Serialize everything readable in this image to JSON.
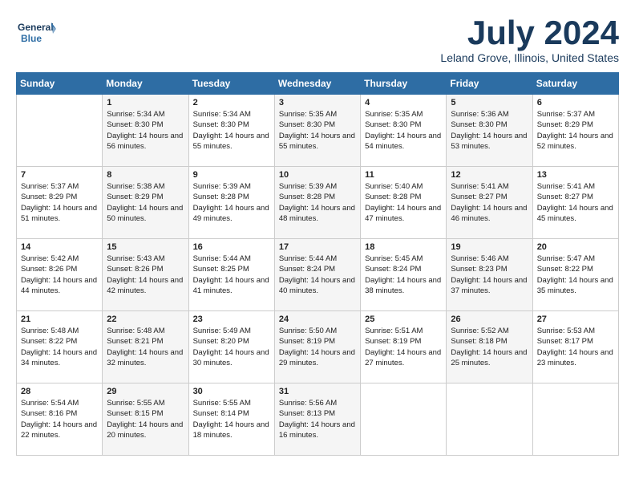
{
  "header": {
    "logo_line1": "General",
    "logo_line2": "Blue",
    "month": "July 2024",
    "location": "Leland Grove, Illinois, United States"
  },
  "days_of_week": [
    "Sunday",
    "Monday",
    "Tuesday",
    "Wednesday",
    "Thursday",
    "Friday",
    "Saturday"
  ],
  "weeks": [
    [
      {
        "num": "",
        "sunrise": "",
        "sunset": "",
        "daylight": ""
      },
      {
        "num": "1",
        "sunrise": "Sunrise: 5:34 AM",
        "sunset": "Sunset: 8:30 PM",
        "daylight": "Daylight: 14 hours and 56 minutes."
      },
      {
        "num": "2",
        "sunrise": "Sunrise: 5:34 AM",
        "sunset": "Sunset: 8:30 PM",
        "daylight": "Daylight: 14 hours and 55 minutes."
      },
      {
        "num": "3",
        "sunrise": "Sunrise: 5:35 AM",
        "sunset": "Sunset: 8:30 PM",
        "daylight": "Daylight: 14 hours and 55 minutes."
      },
      {
        "num": "4",
        "sunrise": "Sunrise: 5:35 AM",
        "sunset": "Sunset: 8:30 PM",
        "daylight": "Daylight: 14 hours and 54 minutes."
      },
      {
        "num": "5",
        "sunrise": "Sunrise: 5:36 AM",
        "sunset": "Sunset: 8:30 PM",
        "daylight": "Daylight: 14 hours and 53 minutes."
      },
      {
        "num": "6",
        "sunrise": "Sunrise: 5:37 AM",
        "sunset": "Sunset: 8:29 PM",
        "daylight": "Daylight: 14 hours and 52 minutes."
      }
    ],
    [
      {
        "num": "7",
        "sunrise": "Sunrise: 5:37 AM",
        "sunset": "Sunset: 8:29 PM",
        "daylight": "Daylight: 14 hours and 51 minutes."
      },
      {
        "num": "8",
        "sunrise": "Sunrise: 5:38 AM",
        "sunset": "Sunset: 8:29 PM",
        "daylight": "Daylight: 14 hours and 50 minutes."
      },
      {
        "num": "9",
        "sunrise": "Sunrise: 5:39 AM",
        "sunset": "Sunset: 8:28 PM",
        "daylight": "Daylight: 14 hours and 49 minutes."
      },
      {
        "num": "10",
        "sunrise": "Sunrise: 5:39 AM",
        "sunset": "Sunset: 8:28 PM",
        "daylight": "Daylight: 14 hours and 48 minutes."
      },
      {
        "num": "11",
        "sunrise": "Sunrise: 5:40 AM",
        "sunset": "Sunset: 8:28 PM",
        "daylight": "Daylight: 14 hours and 47 minutes."
      },
      {
        "num": "12",
        "sunrise": "Sunrise: 5:41 AM",
        "sunset": "Sunset: 8:27 PM",
        "daylight": "Daylight: 14 hours and 46 minutes."
      },
      {
        "num": "13",
        "sunrise": "Sunrise: 5:41 AM",
        "sunset": "Sunset: 8:27 PM",
        "daylight": "Daylight: 14 hours and 45 minutes."
      }
    ],
    [
      {
        "num": "14",
        "sunrise": "Sunrise: 5:42 AM",
        "sunset": "Sunset: 8:26 PM",
        "daylight": "Daylight: 14 hours and 44 minutes."
      },
      {
        "num": "15",
        "sunrise": "Sunrise: 5:43 AM",
        "sunset": "Sunset: 8:26 PM",
        "daylight": "Daylight: 14 hours and 42 minutes."
      },
      {
        "num": "16",
        "sunrise": "Sunrise: 5:44 AM",
        "sunset": "Sunset: 8:25 PM",
        "daylight": "Daylight: 14 hours and 41 minutes."
      },
      {
        "num": "17",
        "sunrise": "Sunrise: 5:44 AM",
        "sunset": "Sunset: 8:24 PM",
        "daylight": "Daylight: 14 hours and 40 minutes."
      },
      {
        "num": "18",
        "sunrise": "Sunrise: 5:45 AM",
        "sunset": "Sunset: 8:24 PM",
        "daylight": "Daylight: 14 hours and 38 minutes."
      },
      {
        "num": "19",
        "sunrise": "Sunrise: 5:46 AM",
        "sunset": "Sunset: 8:23 PM",
        "daylight": "Daylight: 14 hours and 37 minutes."
      },
      {
        "num": "20",
        "sunrise": "Sunrise: 5:47 AM",
        "sunset": "Sunset: 8:22 PM",
        "daylight": "Daylight: 14 hours and 35 minutes."
      }
    ],
    [
      {
        "num": "21",
        "sunrise": "Sunrise: 5:48 AM",
        "sunset": "Sunset: 8:22 PM",
        "daylight": "Daylight: 14 hours and 34 minutes."
      },
      {
        "num": "22",
        "sunrise": "Sunrise: 5:48 AM",
        "sunset": "Sunset: 8:21 PM",
        "daylight": "Daylight: 14 hours and 32 minutes."
      },
      {
        "num": "23",
        "sunrise": "Sunrise: 5:49 AM",
        "sunset": "Sunset: 8:20 PM",
        "daylight": "Daylight: 14 hours and 30 minutes."
      },
      {
        "num": "24",
        "sunrise": "Sunrise: 5:50 AM",
        "sunset": "Sunset: 8:19 PM",
        "daylight": "Daylight: 14 hours and 29 minutes."
      },
      {
        "num": "25",
        "sunrise": "Sunrise: 5:51 AM",
        "sunset": "Sunset: 8:19 PM",
        "daylight": "Daylight: 14 hours and 27 minutes."
      },
      {
        "num": "26",
        "sunrise": "Sunrise: 5:52 AM",
        "sunset": "Sunset: 8:18 PM",
        "daylight": "Daylight: 14 hours and 25 minutes."
      },
      {
        "num": "27",
        "sunrise": "Sunrise: 5:53 AM",
        "sunset": "Sunset: 8:17 PM",
        "daylight": "Daylight: 14 hours and 23 minutes."
      }
    ],
    [
      {
        "num": "28",
        "sunrise": "Sunrise: 5:54 AM",
        "sunset": "Sunset: 8:16 PM",
        "daylight": "Daylight: 14 hours and 22 minutes."
      },
      {
        "num": "29",
        "sunrise": "Sunrise: 5:55 AM",
        "sunset": "Sunset: 8:15 PM",
        "daylight": "Daylight: 14 hours and 20 minutes."
      },
      {
        "num": "30",
        "sunrise": "Sunrise: 5:55 AM",
        "sunset": "Sunset: 8:14 PM",
        "daylight": "Daylight: 14 hours and 18 minutes."
      },
      {
        "num": "31",
        "sunrise": "Sunrise: 5:56 AM",
        "sunset": "Sunset: 8:13 PM",
        "daylight": "Daylight: 14 hours and 16 minutes."
      },
      {
        "num": "",
        "sunrise": "",
        "sunset": "",
        "daylight": ""
      },
      {
        "num": "",
        "sunrise": "",
        "sunset": "",
        "daylight": ""
      },
      {
        "num": "",
        "sunrise": "",
        "sunset": "",
        "daylight": ""
      }
    ]
  ]
}
